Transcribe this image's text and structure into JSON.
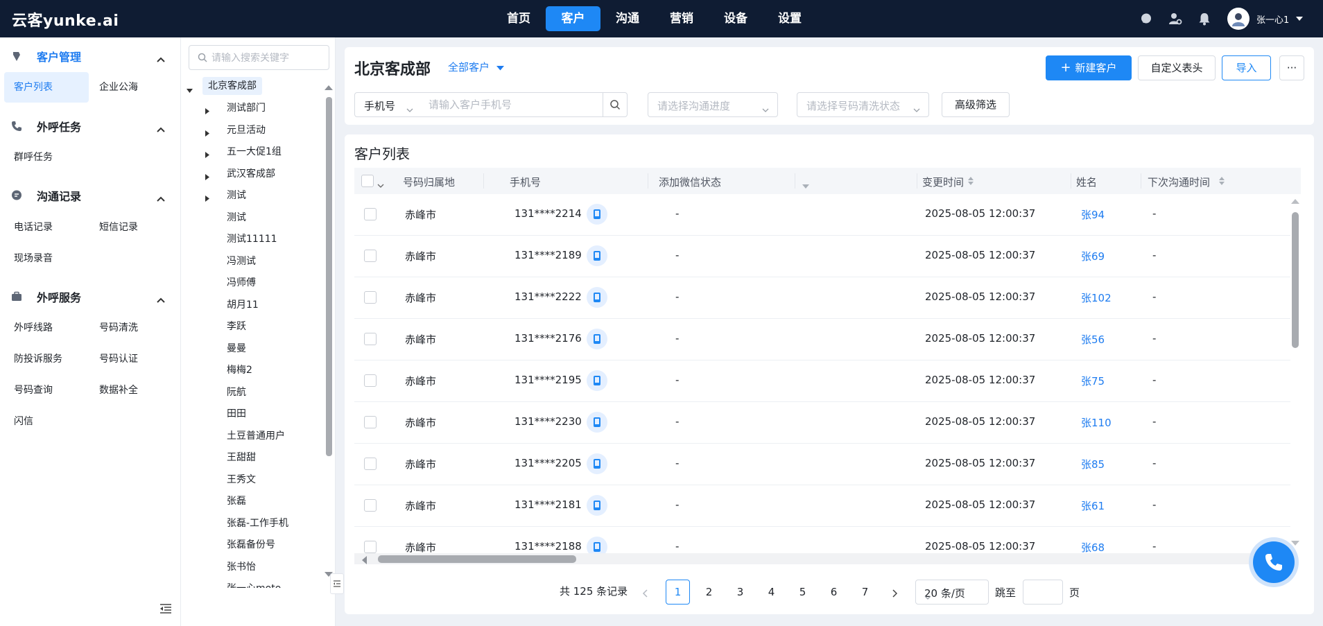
{
  "app": {
    "logo": "云客yunke.ai"
  },
  "nav": [
    {
      "label": "首页",
      "active": false
    },
    {
      "label": "客户",
      "active": true
    },
    {
      "label": "沟通",
      "active": false
    },
    {
      "label": "营销",
      "active": false
    },
    {
      "label": "设备",
      "active": false
    },
    {
      "label": "设置",
      "active": false
    }
  ],
  "user": {
    "name": "张一心1"
  },
  "sidebar": {
    "groups": [
      {
        "title": "客户管理",
        "icon": "customer-manage-icon",
        "items": [
          "客户列表",
          "企业公海"
        ]
      },
      {
        "title": "外呼任务",
        "icon": "phone-task-icon",
        "items": [
          "群呼任务"
        ]
      },
      {
        "title": "沟通记录",
        "icon": "chat-record-icon",
        "items": [
          "电话记录",
          "短信记录",
          "现场录音"
        ]
      },
      {
        "title": "外呼服务",
        "icon": "briefcase-icon",
        "items": [
          "外呼线路",
          "号码清洗",
          "防投诉服务",
          "号码认证",
          "号码查询",
          "数据补全",
          "闪信"
        ]
      }
    ]
  },
  "tree": {
    "search_placeholder": "请输入搜索关键字",
    "root": "北京客成部",
    "nodes": [
      {
        "label": "测试部门",
        "expandable": true
      },
      {
        "label": "元旦活动",
        "expandable": true
      },
      {
        "label": "五一大促1组",
        "expandable": true
      },
      {
        "label": "武汉客成部",
        "expandable": true
      },
      {
        "label": "测试",
        "expandable": true
      },
      {
        "label": "测试",
        "expandable": false
      },
      {
        "label": "测试11111",
        "expandable": false
      },
      {
        "label": "冯测试",
        "expandable": false
      },
      {
        "label": "冯师傅",
        "expandable": false
      },
      {
        "label": "胡月11",
        "expandable": false
      },
      {
        "label": "李跃",
        "expandable": false
      },
      {
        "label": "曼曼",
        "expandable": false
      },
      {
        "label": "梅梅2",
        "expandable": false
      },
      {
        "label": "阮航",
        "expandable": false
      },
      {
        "label": "田田",
        "expandable": false
      },
      {
        "label": "土豆普通用户",
        "expandable": false
      },
      {
        "label": "王甜甜",
        "expandable": false
      },
      {
        "label": "王秀文",
        "expandable": false
      },
      {
        "label": "张磊",
        "expandable": false
      },
      {
        "label": "张磊-工作手机",
        "expandable": false
      },
      {
        "label": "张磊备份号",
        "expandable": false
      },
      {
        "label": "张书怡",
        "expandable": false
      },
      {
        "label": "张一心moto",
        "expandable": false
      }
    ]
  },
  "header": {
    "title": "北京客成部",
    "filter_label": "全部客户",
    "buttons": {
      "new": "新建客户",
      "custom": "自定义表头",
      "import": "导入",
      "more": "···"
    },
    "phone_select": "手机号",
    "phone_placeholder": "请输入客户手机号",
    "progress_placeholder": "请选择沟通进度",
    "clean_placeholder": "请选择号码清洗状态",
    "advanced": "高级筛选"
  },
  "table": {
    "title": "客户列表",
    "columns": [
      "号码归属地",
      "手机号",
      "添加微信状态",
      "变更时间",
      "姓名",
      "下次沟通时间"
    ],
    "rows": [
      {
        "location": "赤峰市",
        "phone": "131****2214",
        "wechat": "-",
        "time": "2025-08-05 12:00:37",
        "name": "张94",
        "next": "-"
      },
      {
        "location": "赤峰市",
        "phone": "131****2189",
        "wechat": "-",
        "time": "2025-08-05 12:00:37",
        "name": "张69",
        "next": "-"
      },
      {
        "location": "赤峰市",
        "phone": "131****2222",
        "wechat": "-",
        "time": "2025-08-05 12:00:37",
        "name": "张102",
        "next": "-"
      },
      {
        "location": "赤峰市",
        "phone": "131****2176",
        "wechat": "-",
        "time": "2025-08-05 12:00:37",
        "name": "张56",
        "next": "-"
      },
      {
        "location": "赤峰市",
        "phone": "131****2195",
        "wechat": "-",
        "time": "2025-08-05 12:00:37",
        "name": "张75",
        "next": "-"
      },
      {
        "location": "赤峰市",
        "phone": "131****2230",
        "wechat": "-",
        "time": "2025-08-05 12:00:37",
        "name": "张110",
        "next": "-"
      },
      {
        "location": "赤峰市",
        "phone": "131****2205",
        "wechat": "-",
        "time": "2025-08-05 12:00:37",
        "name": "张85",
        "next": "-"
      },
      {
        "location": "赤峰市",
        "phone": "131****2181",
        "wechat": "-",
        "time": "2025-08-05 12:00:37",
        "name": "张61",
        "next": "-"
      },
      {
        "location": "赤峰市",
        "phone": "131****2188",
        "wechat": "-",
        "time": "2025-08-05 12:00:37",
        "name": "张68",
        "next": "-"
      }
    ]
  },
  "pager": {
    "total": "共 125 条记录",
    "pages": [
      "1",
      "2",
      "3",
      "4",
      "5",
      "6",
      "7"
    ],
    "current": "1",
    "page_size": "20 条/页",
    "jump_label": "跳至",
    "unit": "页"
  },
  "colors": {
    "primary": "#1e88f5",
    "topbar": "#0f1c33",
    "link": "#1e7cf0"
  }
}
